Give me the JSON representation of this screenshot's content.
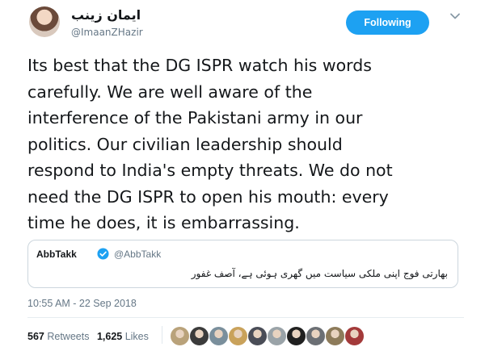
{
  "author": {
    "name": "ایمان زینب",
    "handle": "@ImaanZHazir",
    "avatar_icon": "profile-photo"
  },
  "follow_button": {
    "label": "Following"
  },
  "menu_icon": "chevron-down-icon",
  "tweet": {
    "lines": [
      "Its best that the DG ISPR watch his words",
      "carefully. We are well aware of the",
      "interference of the Pakistani army in our",
      "politics. Our civilian leadership should",
      "respond to India's empty threats. We do not",
      "need the DG ISPR to open his mouth: every",
      "time he does, it is embarrassing."
    ]
  },
  "quote": {
    "name": "AbbTakk",
    "handle": "@AbbTakk",
    "verified_icon": "verified-badge-icon",
    "text": "بھارتی فوج اپنی ملکی سیاست میں گھری ہوئی ہے، آصف غفور"
  },
  "timestamp": "10:55 AM - 22 Sep 2018",
  "stats": {
    "retweets_count": "567",
    "retweets_label": "Retweets",
    "likes_count": "1,625",
    "likes_label": "Likes"
  },
  "colors": {
    "accent": "#1da1f2",
    "text": "#14171a",
    "muted": "#657786",
    "border": "#ccd6dd"
  },
  "likers": [
    {
      "color": "#b9a27a"
    },
    {
      "color": "#3b3b3b"
    },
    {
      "color": "#7a8f9c"
    },
    {
      "color": "#c9a25b"
    },
    {
      "color": "#4a4d57"
    },
    {
      "color": "#9aa3a8"
    },
    {
      "color": "#202020"
    },
    {
      "color": "#6b6f74"
    },
    {
      "color": "#8d7b5a"
    },
    {
      "color": "#a33a3a"
    }
  ]
}
